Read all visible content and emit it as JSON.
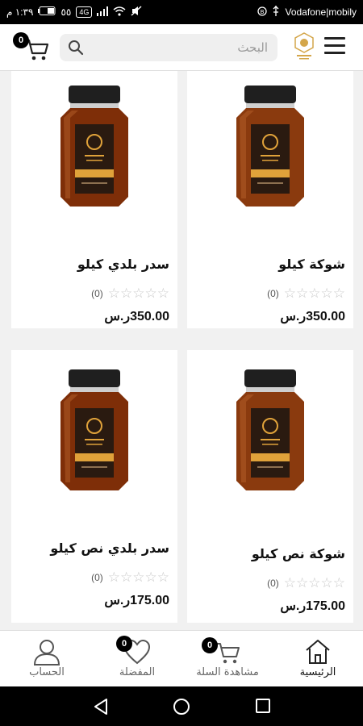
{
  "status_bar": {
    "time": "١:٣٩ م",
    "network_badge": "4G",
    "battery": "٥٥",
    "carrier": "Vodafone|mobily"
  },
  "header": {
    "search_placeholder": "البحث",
    "cart_count": "0"
  },
  "products": [
    {
      "name": "شوكة كيلو",
      "rating_count": "(0)",
      "price": "350.00ر.س",
      "rating": 0
    },
    {
      "name": "سدر بلدي كيلو",
      "rating_count": "(0)",
      "price": "350.00ر.س",
      "rating": 0
    },
    {
      "name": "شوكة نص كيلو",
      "rating_count": "(0)",
      "price": "175.00ر.س",
      "rating": 0
    },
    {
      "name": "سدر بلدي نص كيلو",
      "rating_count": "(0)",
      "price": "175.00ر.س",
      "rating": 0
    }
  ],
  "bottom_nav": {
    "home": "الرئيسية",
    "cart": "مشاهدة السلة",
    "cart_count": "0",
    "favorites": "المفضلة",
    "favorites_count": "0",
    "account": "الحساب"
  },
  "colors": {
    "honey": "#8a3a0e",
    "lid": "#1f1f1f",
    "label_dark": "#2a1a10",
    "label_gold": "#e0a23a"
  }
}
